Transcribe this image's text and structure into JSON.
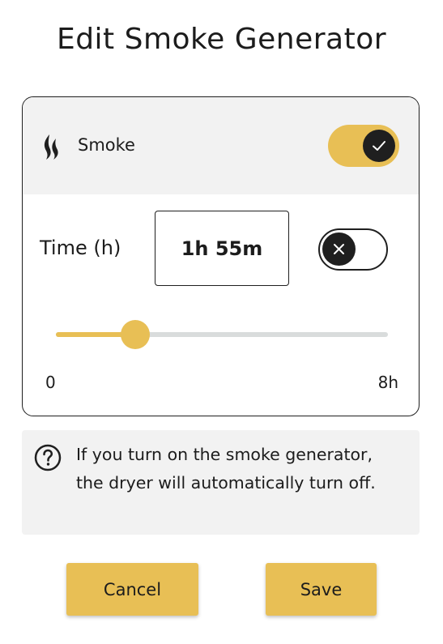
{
  "title": "Edit Smoke Generator",
  "smoke": {
    "icon": "flame-icon",
    "label": "Smoke",
    "enabled": true
  },
  "time": {
    "label": "Time (h)",
    "value": "1h 55m",
    "timer_enabled": false
  },
  "slider": {
    "min_label": "0",
    "max_label": "8h",
    "min": 0,
    "max": 8,
    "value_hours": 1.92
  },
  "info": {
    "icon": "help-icon",
    "text": "If you turn on the smoke generator, the dryer will automatically turn off."
  },
  "buttons": {
    "cancel_label": "Cancel",
    "save_label": "Save"
  },
  "colors": {
    "accent": "#e8bf55",
    "dark": "#1f1f1f",
    "panel": "#f2f2f2",
    "track": "#d9dcdc"
  }
}
